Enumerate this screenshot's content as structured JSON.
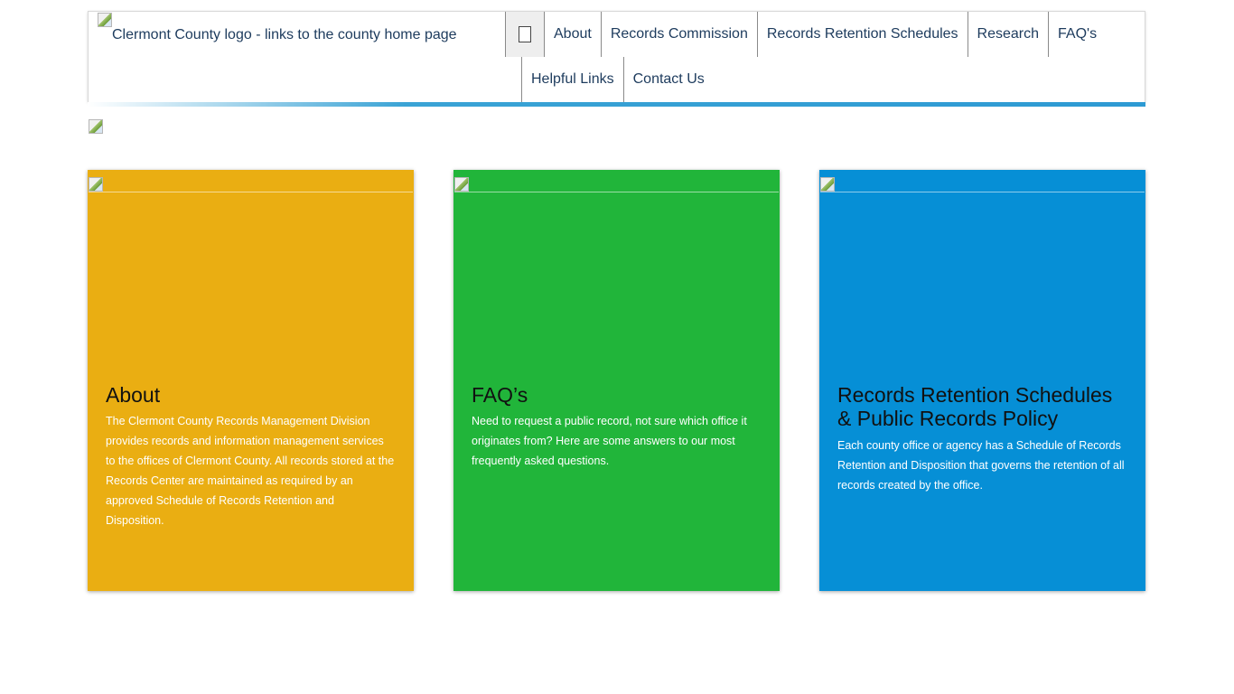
{
  "header": {
    "logo_alt": "Clermont County logo - links to the county home page",
    "nav_toggle_icon": "checkbox-square-icon",
    "nav_items": [
      {
        "label": "About"
      },
      {
        "label": "Records Commission"
      },
      {
        "label": "Records Retention Schedules"
      },
      {
        "label": "Research"
      },
      {
        "label": "FAQ's"
      },
      {
        "label": "Helpful Links"
      },
      {
        "label": "Contact Us"
      }
    ]
  },
  "colors": {
    "link_text": "#1d3b5d",
    "stripe": "#2d9ad3",
    "card_about": "#eaae12",
    "card_faq": "#21b53a",
    "card_retention": "#068fd6"
  },
  "cards": [
    {
      "title": "About",
      "text": "The Clermont County Records Management Division provides records and information management services to the offices of Clermont County. All records stored at the Records Center are maintained as required by an approved Schedule of Records Retention and Disposition."
    },
    {
      "title": "FAQ’s",
      "text": "Need to request a public record, not sure which office it originates from? Here are some answers to our most frequently asked questions."
    },
    {
      "title": "Records Retention Schedules & Public Records Policy",
      "text": "Each county office or agency has a Schedule of Records Retention and Disposition that governs the retention of all records created by the office."
    }
  ]
}
